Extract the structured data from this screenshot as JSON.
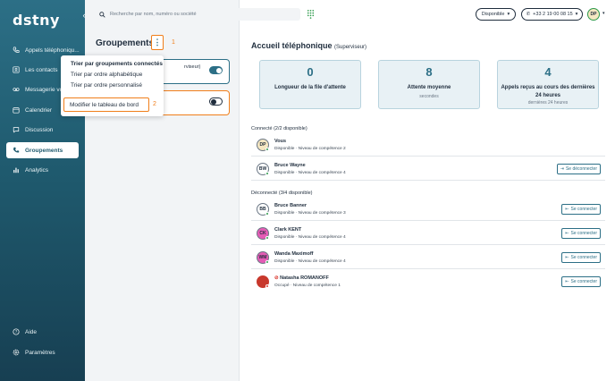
{
  "sidebar": {
    "logo": "dstny",
    "collapse_icon": "chevron-left-icon",
    "items": [
      {
        "label": "Appels téléphoniqu...",
        "icon": "phone-icon"
      },
      {
        "label": "Les contacts",
        "icon": "contacts-icon"
      },
      {
        "label": "Messagerie vo...",
        "icon": "voicemail-icon"
      },
      {
        "label": "Calendrier",
        "icon": "calendar-icon"
      },
      {
        "label": "Discussion",
        "icon": "chat-icon"
      },
      {
        "label": "Groupements",
        "icon": "group-phone-icon",
        "active": true
      },
      {
        "label": "Analytics",
        "icon": "chart-icon"
      }
    ],
    "bottom_items": [
      {
        "label": "Aide",
        "icon": "help-icon"
      },
      {
        "label": "Paramètres",
        "icon": "settings-icon"
      }
    ]
  },
  "topbar": {
    "search_placeholder": "Recherche par nom, numéro ou société",
    "status_label": "Disponible",
    "phone_label": "+33 2 19 00 08 15",
    "user_initials": "DP"
  },
  "left_panel": {
    "title": "Groupements",
    "annotation_1": "1",
    "annotation_2": "2",
    "card1_text": "rviseur)",
    "menu": {
      "sort_heading": "Trier par groupements connectés",
      "sort_alpha": "Trier par ordre alphabétique",
      "sort_custom": "Trier par ordre personnalisé",
      "modify": "Modifier le tableau de bord"
    }
  },
  "main": {
    "title": "Accueil téléphonique",
    "title_sub": "(Superviseur)",
    "stats": [
      {
        "value": "0",
        "label": "Longueur de la file d'attente",
        "sub": ""
      },
      {
        "value": "8",
        "label": "Attente moyenne",
        "sub": "secondes"
      },
      {
        "value": "4",
        "label": "Appels reçus au cours des dernières 24 heures",
        "sub": "dernières 24 heures"
      }
    ],
    "connected_title": "Connecté (2/2 disponible)",
    "disconnected_title": "Déconnecté (3/4 disponible)",
    "connected": [
      {
        "initials": "DP",
        "name": "Vous",
        "status": "Disponible · Niveau de compétence 2",
        "avatar_color": "#f5e7c2",
        "button": ""
      },
      {
        "initials": "BW",
        "name": "Bruce Wayne",
        "status": "Disponible · Niveau de compétence 4",
        "avatar_color": "#ffffff",
        "button": "Se déconnecter"
      }
    ],
    "disconnected": [
      {
        "initials": "BB",
        "name": "Bruce Banner",
        "status": "Disponible · Niveau de compétence 3",
        "avatar_color": "#ffffff",
        "button": "Se connecter",
        "dot": "green"
      },
      {
        "initials": "CK",
        "name": "Clark KENT",
        "status": "Disponible · Niveau de compétence 4",
        "avatar_color": "#e45cb5",
        "button": "Se connecter",
        "dot": "green"
      },
      {
        "initials": "WM",
        "name": "Wanda Maximoff",
        "status": "Disponible · Niveau de compétence 4",
        "avatar_color": "#e45cb5",
        "button": "Se connecter",
        "dot": "green"
      },
      {
        "initials": "",
        "name": "Natasha ROMANOFF",
        "status": "Occupé · Niveau de compétence 1",
        "avatar_color": "#c8382c",
        "button": "Se connecter",
        "dot": "red"
      }
    ]
  }
}
